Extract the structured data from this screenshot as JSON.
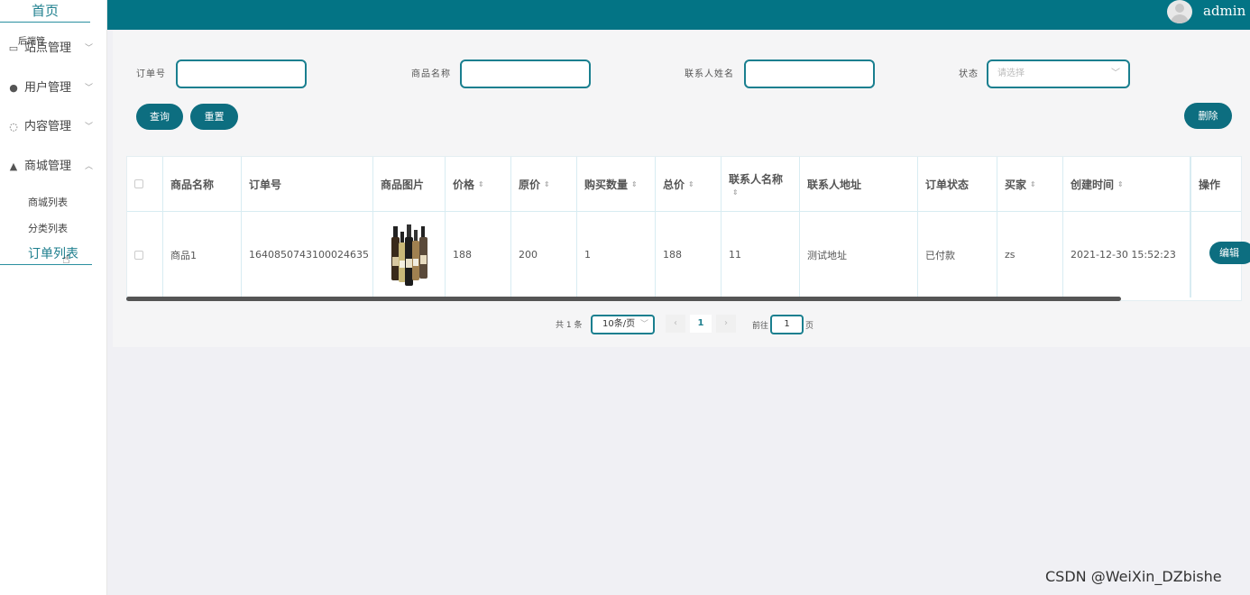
{
  "sidebar": {
    "home": "首页",
    "home_sub": "后端管",
    "menus": [
      {
        "label": "站点管理",
        "icon": "monitor-icon"
      },
      {
        "label": "用户管理",
        "icon": "user-icon"
      },
      {
        "label": "内容管理",
        "icon": "chat-icon"
      },
      {
        "label": "商城管理",
        "icon": "lock-icon"
      }
    ],
    "submenu": [
      "商城列表",
      "分类列表"
    ],
    "active": "订单列表"
  },
  "header": {
    "user": "admin"
  },
  "filters": {
    "order_no_label": "订单号",
    "product_name_label": "商品名称",
    "contact_label": "联系人姓名",
    "status_label": "状态",
    "status_placeholder": "请选择"
  },
  "buttons": {
    "query": "查询",
    "reset": "重置",
    "delete": "删除",
    "edit": "编辑"
  },
  "table": {
    "columns": [
      "商品名称",
      "订单号",
      "商品图片",
      "价格",
      "原价",
      "购买数量",
      "总价",
      "联系人名称",
      "联系人地址",
      "订单状态",
      "买家",
      "创建时间",
      "操作"
    ],
    "rows": [
      {
        "name": "商品1",
        "order_no": "1640850743100024635",
        "price": "188",
        "original_price": "200",
        "quantity": "1",
        "total": "188",
        "contact": "11",
        "address": "测试地址",
        "status": "已付款",
        "buyer": "zs",
        "created": "2021-12-30 15:52:23"
      }
    ]
  },
  "pagination": {
    "total": "共 1 条",
    "page_size": "10条/页",
    "current": "1",
    "goto": "前往",
    "goto_value": "1",
    "page_suffix": "页"
  },
  "watermark": "CSDN @WeiXin_DZbishe"
}
